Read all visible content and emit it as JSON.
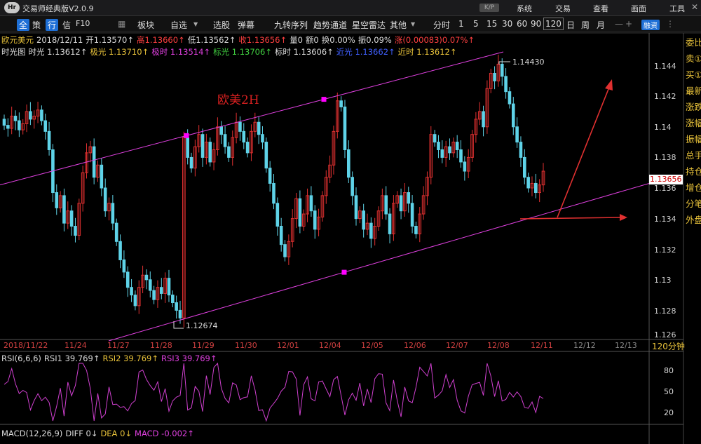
{
  "titlebar": {
    "logo": "Hr",
    "app_title": "交易师经典版V2.0.9",
    "ver_badge": "K/P",
    "menus": [
      "系统",
      "交易",
      "查看",
      "画面",
      "工具"
    ]
  },
  "toolbar": {
    "items": [
      "全",
      "策",
      "行",
      "信",
      "F10",
      "板块",
      "自选",
      "选股",
      "弹幕",
      "九转序列",
      "趋势通道",
      "星空雷达",
      "其他"
    ],
    "periods": [
      "分时",
      "1",
      "5",
      "15",
      "30",
      "60",
      "90",
      "120",
      "日",
      "周",
      "月"
    ],
    "selected_period": "120",
    "right_badge": "融资"
  },
  "legend_line1": [
    {
      "text": "欧元美元",
      "color": "#e8c23a"
    },
    {
      "text": "2018/12/11",
      "color": "#dddddd"
    },
    {
      "text": "开1.13570↑",
      "color": "#dddddd"
    },
    {
      "text": "高1.13660↑",
      "color": "#ff4040"
    },
    {
      "text": "低1.13562↑",
      "color": "#dddddd"
    },
    {
      "text": "收1.13656↑",
      "color": "#ff4040"
    },
    {
      "text": "量0",
      "color": "#dddddd"
    },
    {
      "text": "额0",
      "color": "#dddddd"
    },
    {
      "text": "换0.00%",
      "color": "#dddddd"
    },
    {
      "text": "振0.09%",
      "color": "#dddddd"
    },
    {
      "text": "涨(0.00083)0.07%↑",
      "color": "#ff4040"
    }
  ],
  "legend_line2": [
    {
      "text": "时光图",
      "color": "#dddddd"
    },
    {
      "text": "时光 1.13612↑",
      "color": "#dddddd"
    },
    {
      "text": "极光 1.13710↑",
      "color": "#e8c23a"
    },
    {
      "text": "极时 1.13514↑",
      "color": "#e040e0"
    },
    {
      "text": "标光 1.13706↑",
      "color": "#40d040"
    },
    {
      "text": "标时 1.13606↑",
      "color": "#dddddd"
    },
    {
      "text": "近光 1.13662↑",
      "color": "#4060ff"
    },
    {
      "text": "近时 1.13612↑",
      "color": "#e8c23a"
    }
  ],
  "chart_title": "欧美2H",
  "high_label": "1.14430",
  "low_label": "1.12674",
  "last_price_tag": "1.13656",
  "period_label": "120分钟",
  "rsi_legend": [
    {
      "text": "RSI(6,6,6)",
      "color": "#dddddd"
    },
    {
      "text": "RSI1 39.769↑",
      "color": "#dddddd"
    },
    {
      "text": "RSI2 39.769↑",
      "color": "#e8c23a"
    },
    {
      "text": "RSI3 39.769↑",
      "color": "#e040e0"
    }
  ],
  "macd_legend": [
    {
      "text": "MACD(12,26,9)",
      "color": "#dddddd"
    },
    {
      "text": "DIFF 0↓",
      "color": "#dddddd"
    },
    {
      "text": "DEA 0↓",
      "color": "#e8c23a"
    },
    {
      "text": "MACD -0.002↑",
      "color": "#e040e0"
    }
  ],
  "right_panel": [
    "委比",
    "卖①",
    "买①",
    "最新",
    "涨跌",
    "涨幅",
    "振幅",
    "总手",
    "持仓",
    "增仓",
    "分笔",
    "外盘"
  ],
  "colors": {
    "up": "#e03030",
    "down": "#5fd3e8",
    "channel": "#e040e0",
    "arrow": "#e03030",
    "rsi": "#d040d0"
  },
  "chart_data": {
    "type": "candlestick",
    "title": "欧美2H",
    "ylim": [
      1.1255,
      1.1455
    ],
    "yticks": [
      1.126,
      1.128,
      1.13,
      1.132,
      1.134,
      1.136,
      1.138,
      1.14,
      1.142,
      1.144
    ],
    "xticks": [
      "2018/11/22",
      "11/24",
      "11/27",
      "11/28",
      "11/29",
      "11/30",
      "12/01",
      "12/04",
      "12/05",
      "12/06",
      "12/07",
      "12/08",
      "12/11",
      "12/12",
      "12/13"
    ],
    "series_close": [
      1.1396,
      1.1394,
      1.1402,
      1.1399,
      1.1393,
      1.1397,
      1.1405,
      1.14,
      1.1402,
      1.1406,
      1.1399,
      1.1392,
      1.138,
      1.1352,
      1.1342,
      1.135,
      1.1332,
      1.134,
      1.133,
      1.1324,
      1.1345,
      1.1365,
      1.1378,
      1.1382,
      1.1362,
      1.137,
      1.1355,
      1.134,
      1.1345,
      1.1332,
      1.132,
      1.1308,
      1.13,
      1.129,
      1.1285,
      1.1278,
      1.129,
      1.1298,
      1.1295,
      1.1288,
      1.1282,
      1.129,
      1.1286,
      1.1296,
      1.1285,
      1.128,
      1.1275,
      1.127,
      1.1388,
      1.1375,
      1.1368,
      1.1382,
      1.139,
      1.1375,
      1.1385,
      1.1372,
      1.138,
      1.1395,
      1.139,
      1.1382,
      1.1375,
      1.1388,
      1.1398,
      1.1392,
      1.1385,
      1.1378,
      1.1392,
      1.1398,
      1.139,
      1.1385,
      1.1368,
      1.1358,
      1.1345,
      1.133,
      1.1318,
      1.131,
      1.132,
      1.1335,
      1.1348,
      1.133,
      1.1338,
      1.135,
      1.134,
      1.1328,
      1.1336,
      1.135,
      1.1362,
      1.137,
      1.1392,
      1.1412,
      1.1408,
      1.138,
      1.1362,
      1.135,
      1.1335,
      1.134,
      1.1328,
      1.1332,
      1.1322,
      1.133,
      1.134,
      1.135,
      1.1338,
      1.1325,
      1.1345,
      1.135,
      1.134,
      1.1352,
      1.1345,
      1.133,
      1.1325,
      1.1338,
      1.135,
      1.1362,
      1.139,
      1.1385,
      1.138,
      1.1375,
      1.1382,
      1.1378,
      1.1385,
      1.138,
      1.1372,
      1.1366,
      1.1375,
      1.139,
      1.14,
      1.1405,
      1.1395,
      1.142,
      1.143,
      1.1425,
      1.1436,
      1.1428,
      1.1418,
      1.141,
      1.1395,
      1.1385,
      1.1375,
      1.1362,
      1.1355,
      1.1358,
      1.1352,
      1.1357,
      1.1366
    ],
    "channel_upper": {
      "x": [
        "2018/11/22",
        "12/08"
      ],
      "y": [
        1.1357,
        1.1444
      ]
    },
    "channel_lower": {
      "x": [
        "11/27",
        "12/13"
      ],
      "y": [
        1.1255,
        1.1358
      ]
    },
    "rsi": {
      "name": "RSI3",
      "last": 39.769,
      "yticks": [
        20,
        50,
        80
      ]
    }
  }
}
